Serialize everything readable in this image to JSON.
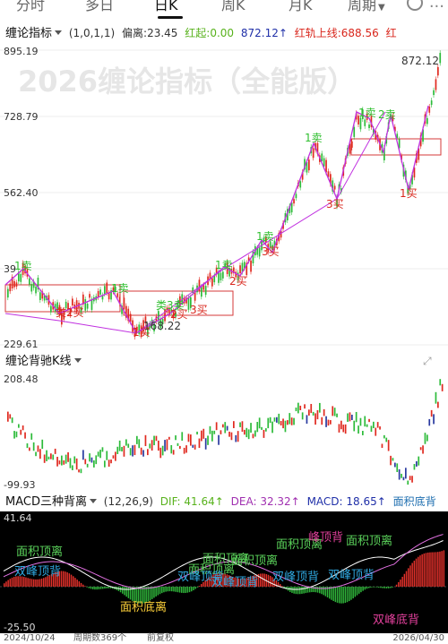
{
  "tabs": {
    "items": [
      "分时",
      "多日",
      "日K",
      "周K",
      "月K",
      "周期"
    ],
    "active_index": 2,
    "more_label": "..."
  },
  "main_indicator": {
    "name": "缠论指标",
    "params": "(1,0,1,1)",
    "items": [
      {
        "label": "偏离:",
        "value": "23.45",
        "color": "#333333"
      },
      {
        "label": "红起:",
        "value": "0.00",
        "color": "#58b21c"
      },
      {
        "label": "",
        "value": "872.12↑",
        "color": "#1f2fa8"
      },
      {
        "label": "红轨上线:",
        "value": "688.56",
        "color": "#d9261c"
      },
      {
        "label": "红",
        "value": "",
        "color": "#d9261c"
      }
    ]
  },
  "main_chart": {
    "watermark": "2026缠论指标（全能版）",
    "y_ticks": [
      "895.19",
      "728.79",
      "562.40",
      "39",
      "229.61"
    ],
    "high_label": "872.12",
    "low_label": "168.22",
    "annotations": {
      "buy1": "1买",
      "sell1": "1卖",
      "buy2": "2买",
      "sell2": "2卖",
      "buy3": "3买",
      "sell3": "3卖",
      "buy2b": "类2买",
      "sell3_2": "类3卖",
      "sell1_top": "1卖",
      "sell2_top": "2卖",
      "sell1_mid": "1卖",
      "buy2_mid": "2买",
      "buy3_mid": "3买",
      "sell3_left": "1卖"
    }
  },
  "sub1": {
    "name": "缠论背驰K线",
    "y_ticks": [
      "208.48",
      "-99.93"
    ]
  },
  "sub2": {
    "name": "MACD三种背离",
    "params": "(12,26,9)",
    "dif_label": "DIF: 41.64↑",
    "dea_label": "DEA: 32.32↑",
    "macd_label": "MACD: 18.65↑",
    "extra_label": "面积底背",
    "y_ticks": [
      "41.64",
      "-25.50"
    ],
    "annotations": {
      "a1": "面积顶离",
      "a2": "双峰顶背",
      "a3": "面积底离",
      "a4": "面积顶离",
      "a5": "面积顶离",
      "a6": "面积顶离",
      "a7": "双峰顶背",
      "a8": "双峰顶背",
      "a9": "双峰顶背",
      "a10": "面积顶离",
      "a11": "峰顶背",
      "a12": "面积顶离",
      "a13": "双峰顶背",
      "a14": "双峰底背"
    }
  },
  "footer": {
    "start_date": "2024/10/24",
    "period_count": "周期数369个",
    "adjust": "前复权",
    "end_date": "2026/04/30"
  },
  "colors": {
    "up": "#e02a20",
    "down": "#2dbb3a",
    "pen_line": "#c030e0",
    "pivot_box": "#d63a3a",
    "green_text": "#2fbf2f",
    "red_text": "#d9261c",
    "macd_bg": "#000000"
  }
}
